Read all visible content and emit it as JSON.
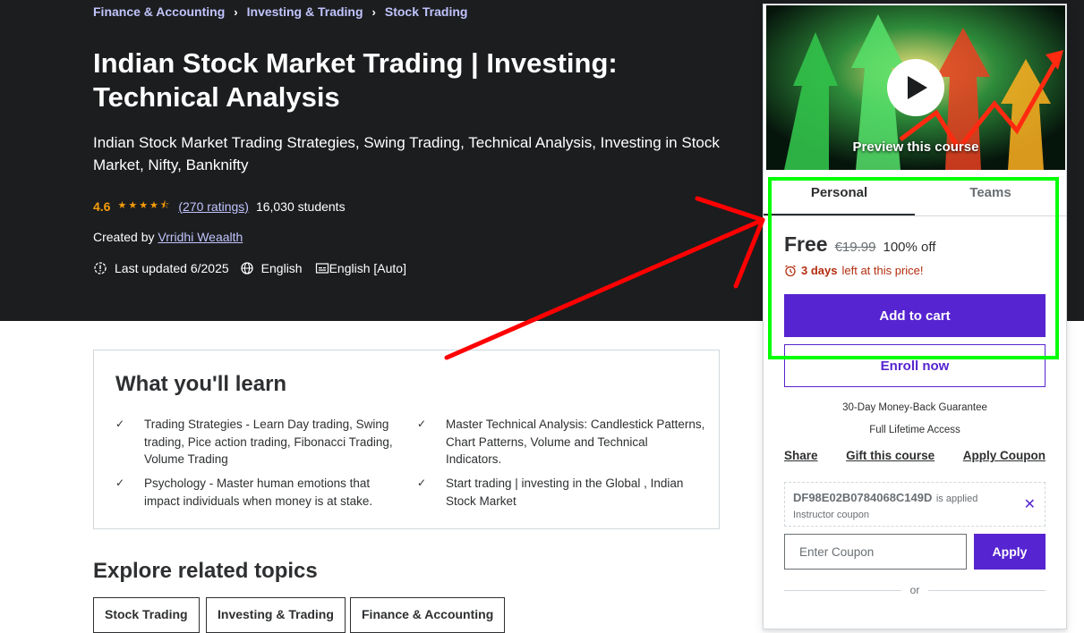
{
  "breadcrumb": [
    "Finance & Accounting",
    "Investing & Trading",
    "Stock Trading"
  ],
  "course": {
    "title": "Indian Stock Market Trading | Investing: Technical Analysis",
    "subtitle": "Indian Stock Market Trading Strategies, Swing Trading, Technical Analysis, Investing in Stock Market, Nifty, Banknifty",
    "rating": "4.6",
    "rating_count": "(270 ratings)",
    "students": "16,030 students",
    "created_by_label": "Created by",
    "instructor": "Vrridhi Weaalth",
    "last_updated": "Last updated 6/2025",
    "language": "English",
    "captions": "English [Auto]"
  },
  "learn": {
    "title": "What you'll learn",
    "items": [
      "Trading Strategies - Learn Day trading, Swing trading, Pice action trading, Fibonacci Trading, Volume Trading",
      "Master Technical Analysis: Candlestick Patterns, Chart Patterns, Volume and Technical Indicators.",
      "Psychology - Master human emotions that impact individuals when money is at stake.",
      "Start trading | investing in the Global , Indian Stock Market"
    ]
  },
  "explore": {
    "title": "Explore related topics",
    "topics": [
      "Stock Trading",
      "Investing & Trading",
      "Finance & Accounting"
    ]
  },
  "card": {
    "preview_label": "Preview this course",
    "tabs": [
      "Personal",
      "Teams"
    ],
    "price_now": "Free",
    "price_old": "€19.99",
    "discount": "100% off",
    "timer_bold": "3 days",
    "timer_rest": "left at this price!",
    "add_to_cart": "Add to cart",
    "enroll_now": "Enroll now",
    "guarantee": "30-Day Money-Back Guarantee",
    "access": "Full Lifetime Access",
    "links": [
      "Share",
      "Gift this course",
      "Apply Coupon"
    ],
    "coupon_code": "DF98E02B0784068C149D",
    "coupon_applied_text": "is applied",
    "coupon_type": "Instructor coupon",
    "coupon_placeholder": "Enter Coupon",
    "apply": "Apply",
    "or": "or"
  },
  "colors": {
    "hero_bg": "#1c1d1f",
    "brand_purple": "#5624d0",
    "link_lavender": "#c0c4fc",
    "star_orange": "#f69c08",
    "annotation_red": "#ff0000",
    "annotation_green": "#00ff00"
  }
}
